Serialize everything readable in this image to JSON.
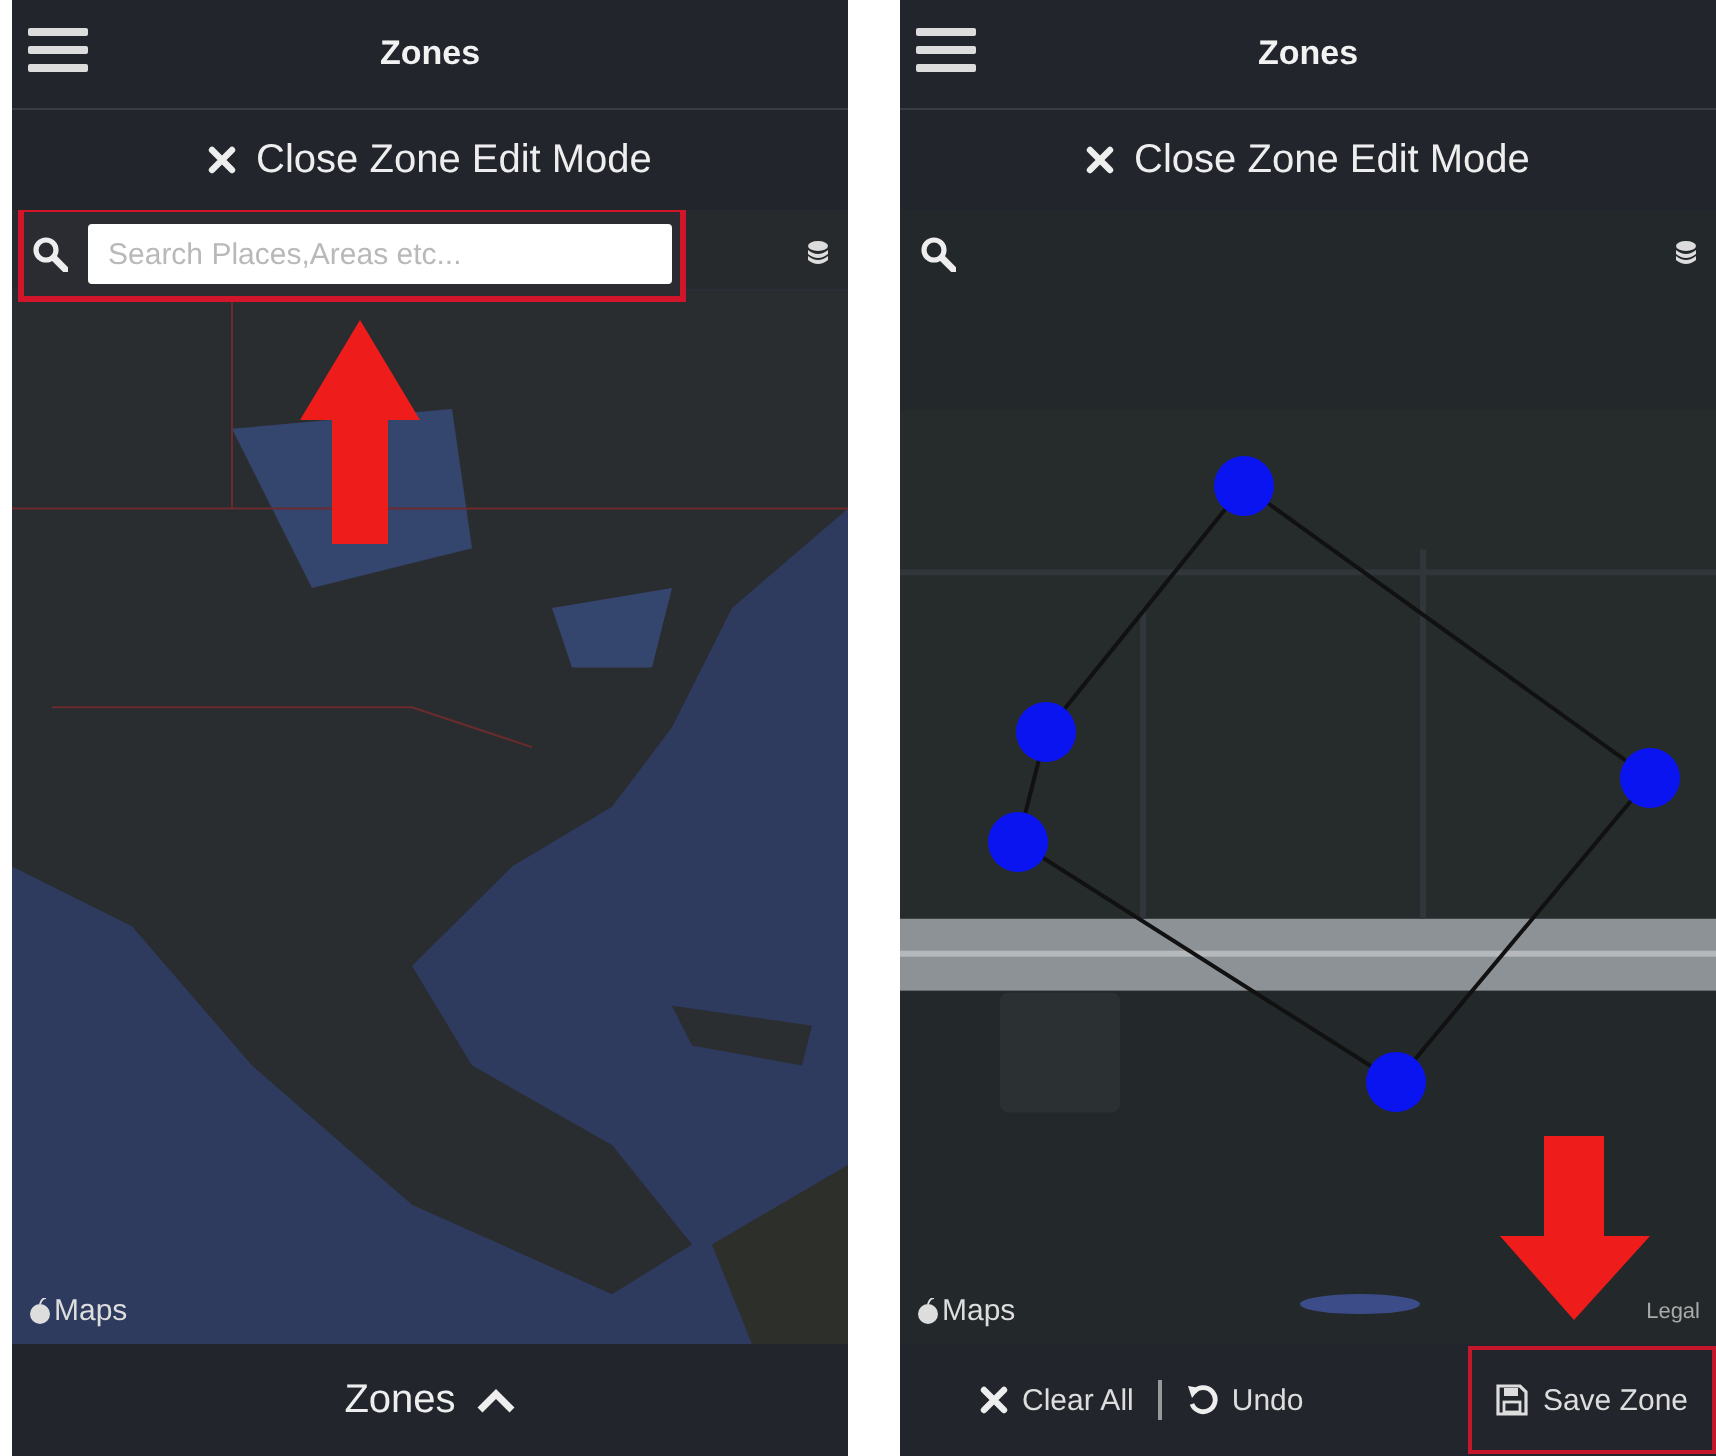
{
  "screens": [
    {
      "title": "Zones",
      "edit_button": "Close Zone Edit Mode",
      "search": {
        "placeholder": "Search Places,Areas etc...",
        "highlighted": true
      },
      "map": {
        "kind": "continent",
        "attribution": "Maps"
      },
      "footer": {
        "kind": "drawer",
        "label": "Zones"
      },
      "annotation": {
        "kind": "arrow-up"
      }
    },
    {
      "title": "Zones",
      "edit_button": "Close Zone Edit Mode",
      "map": {
        "kind": "zone",
        "attribution": "Maps",
        "legal": "Legal"
      },
      "footer": {
        "kind": "toolbar",
        "buttons": [
          {
            "kind": "close",
            "label": "Clear All",
            "highlighted": false
          },
          {
            "kind": "undo",
            "label": "Undo",
            "highlighted": false
          },
          {
            "kind": "save",
            "label": "Save Zone",
            "highlighted": true
          }
        ]
      },
      "annotation": {
        "kind": "arrow-down"
      }
    }
  ]
}
